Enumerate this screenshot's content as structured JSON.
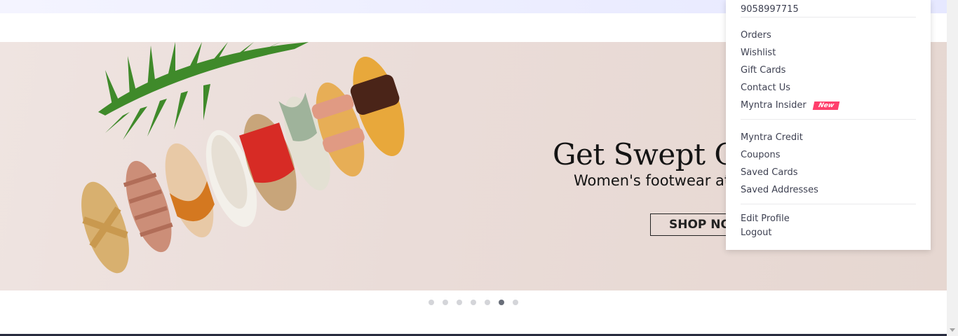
{
  "banner": {
    "headline": "Get Swept Off",
    "subline": "Women's footwear at",
    "cta_label": "SHOP NO"
  },
  "carousel": {
    "total_slides": 7,
    "active_index": 5
  },
  "account_menu": {
    "phone": "9058997715",
    "group1": [
      {
        "label": "Orders"
      },
      {
        "label": "Wishlist"
      },
      {
        "label": "Gift Cards"
      },
      {
        "label": "Contact Us"
      },
      {
        "label": "Myntra Insider",
        "badge": "New"
      }
    ],
    "group2": [
      {
        "label": "Myntra Credit"
      },
      {
        "label": "Coupons"
      },
      {
        "label": "Saved Cards"
      },
      {
        "label": "Saved Addresses"
      }
    ],
    "group3": [
      {
        "label": "Edit Profile"
      },
      {
        "label": "Logout"
      }
    ]
  },
  "colors": {
    "badge": "#ff3f6c",
    "menu_text": "#3e4152",
    "banner_bg": "#eadcd8",
    "dot_active": "#696e79",
    "dot_inactive": "#d4d5d9"
  }
}
